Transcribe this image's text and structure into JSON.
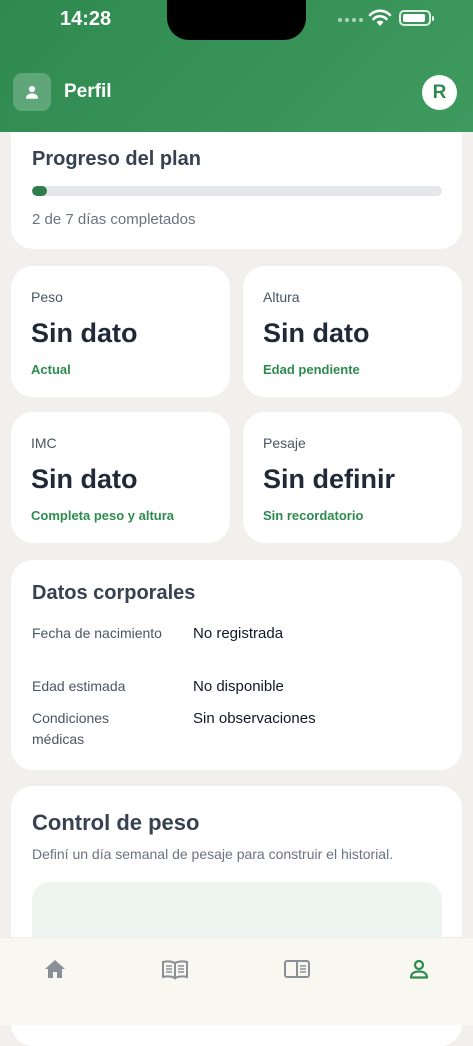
{
  "status_bar": {
    "time": "14:28"
  },
  "header": {
    "title": "Perfil",
    "avatar_initial": "R"
  },
  "plan": {
    "title": "Progreso del plan",
    "summary": "2 de 7 días completados",
    "completed_days": 2,
    "total_days": 7
  },
  "stats": [
    {
      "label": "Peso",
      "value": "Sin dato",
      "hint": "Actual"
    },
    {
      "label": "Altura",
      "value": "Sin dato",
      "hint": "Edad pendiente"
    },
    {
      "label": "IMC",
      "value": "Sin dato",
      "hint": "Completa peso y altura"
    },
    {
      "label": "Pesaje",
      "value": "Sin definir",
      "hint": "Sin recordatorio"
    }
  ],
  "body_data": {
    "title": "Datos corporales",
    "rows": [
      {
        "label": "Fecha de nacimiento",
        "value": "No registrada"
      },
      {
        "label": "Edad estimada",
        "value": "No disponible"
      },
      {
        "label": "Condiciones médicas",
        "value": "Sin observaciones"
      }
    ]
  },
  "weight_control": {
    "title": "Control de peso",
    "subtitle": "Definí un día semanal de pesaje para construir el historial."
  },
  "tabs": [
    {
      "icon": "home-icon",
      "active": false
    },
    {
      "icon": "open-book-icon",
      "active": false
    },
    {
      "icon": "reader-icon",
      "active": false
    },
    {
      "icon": "person-icon",
      "active": true
    }
  ],
  "colors": {
    "brand_green": "#2f8a4f",
    "accent_text": "#2e8b4f",
    "inactive_icon": "#8a8f98"
  }
}
